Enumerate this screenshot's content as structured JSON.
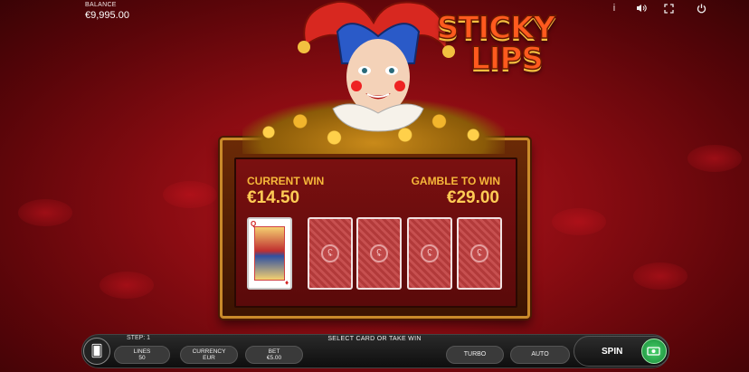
{
  "balance": {
    "label": "BALANCE",
    "value": "€9,995.00"
  },
  "top_icons": [
    "info-icon",
    "sound-icon",
    "fullscreen-icon",
    "power-icon"
  ],
  "logo": {
    "line1": "STICKY",
    "line2": "LIPS"
  },
  "gamble": {
    "current_win_label": "CURRENT WIN",
    "current_win_value": "€14.50",
    "gamble_to_win_label": "GAMBLE TO WIN",
    "gamble_to_win_value": "€29.00",
    "revealed_card": {
      "rank": "Q",
      "suit": "♦"
    },
    "hidden_cards": 4
  },
  "bottom_bar": {
    "step": "STEP: 1",
    "message": "SELECT CARD OR TAKE WIN",
    "lines_label": "LINES",
    "lines_value": "50",
    "currency_label": "CURRENCY",
    "currency_value": "EUR",
    "bet_label": "BET",
    "bet_value": "€5.00",
    "turbo_label": "TURBO",
    "auto_label": "AUTO",
    "spin_label": "SPIN"
  },
  "colors": {
    "accent_gold": "#f6b83a",
    "background_red": "#8a0c12",
    "spin_green": "#2fb350"
  }
}
